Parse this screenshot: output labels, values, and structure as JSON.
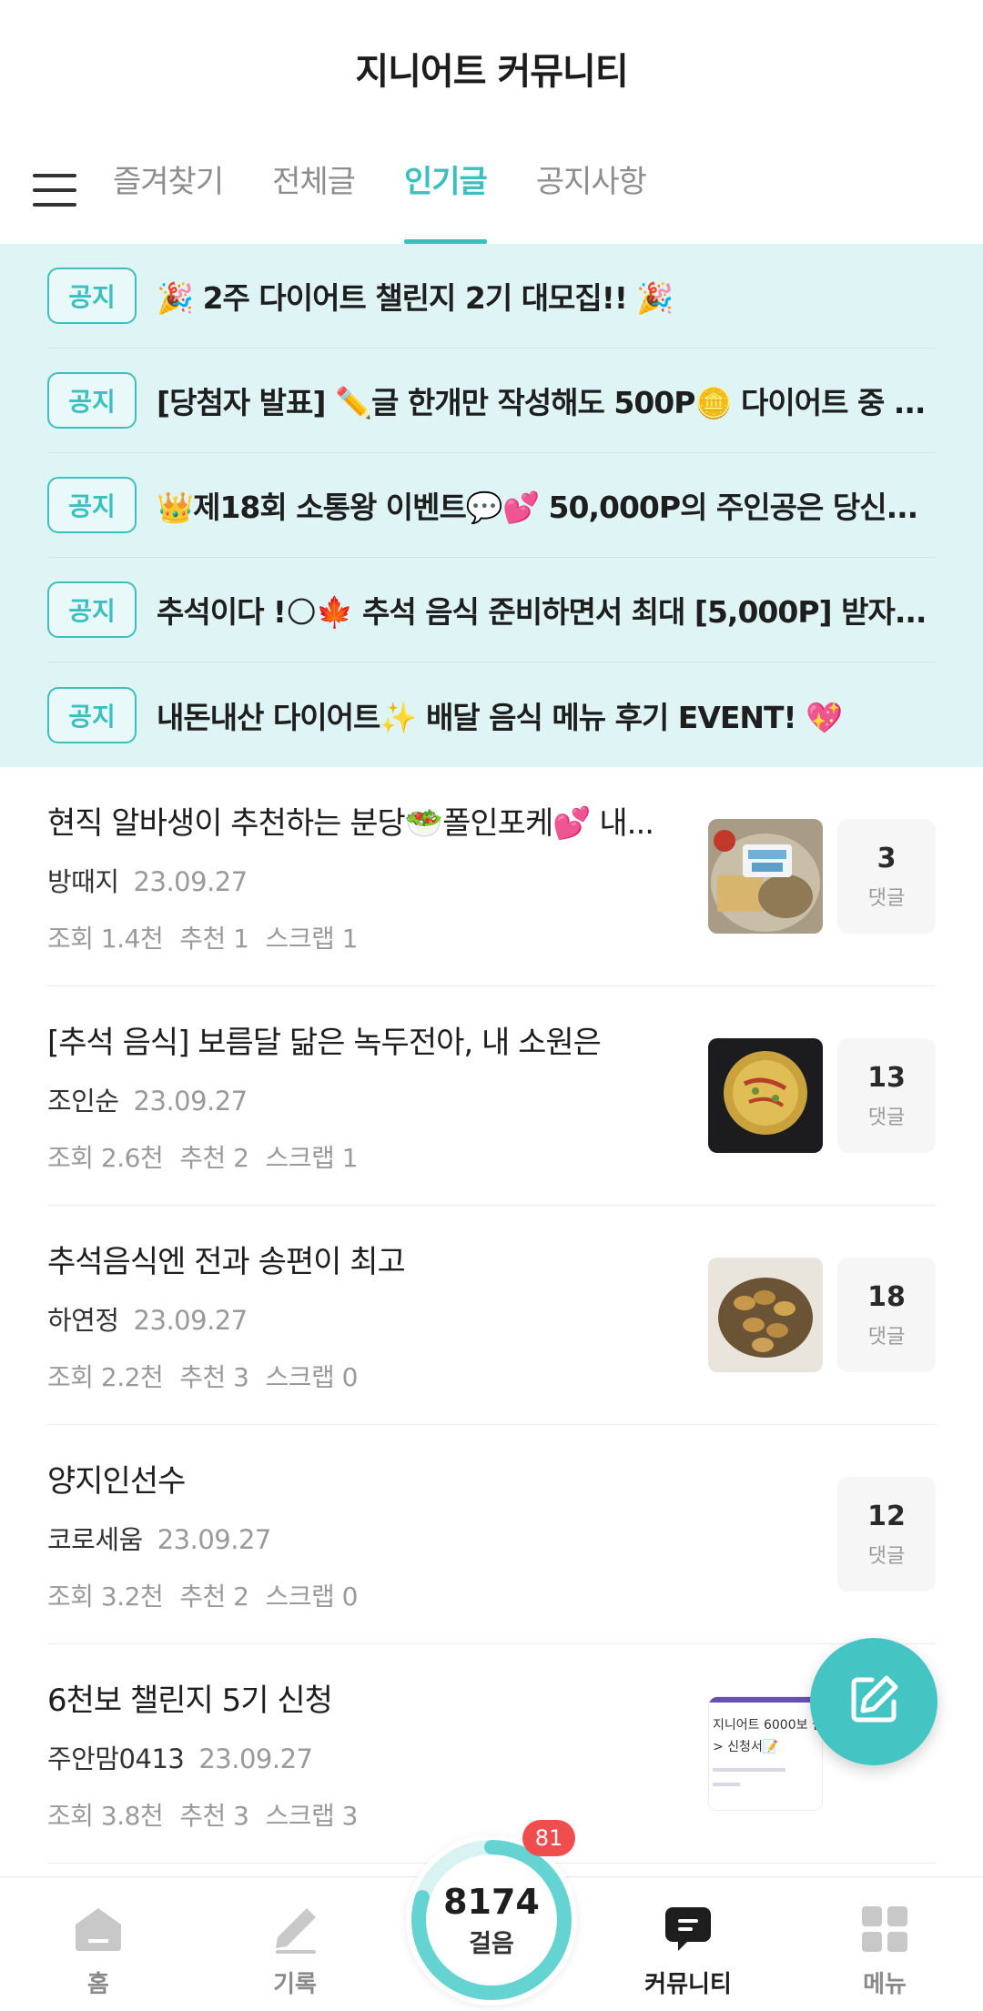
{
  "header": {
    "title": "지니어트 커뮤니티"
  },
  "tabs": [
    {
      "label": "즐겨찾기",
      "active": false
    },
    {
      "label": "전체글",
      "active": false
    },
    {
      "label": "인기글",
      "active": true
    },
    {
      "label": "공지사항",
      "active": false
    }
  ],
  "notices": [
    {
      "badge": "공지",
      "title": "🎉 2주 다이어트 챌린지 2기 대모집!! 🎉"
    },
    {
      "badge": "공지",
      "title": "[당첨자 발표] ✏️글 한개만 작성해도 500P🪙 다이어트 중 ..."
    },
    {
      "badge": "공지",
      "title": "👑제18회 소통왕 이벤트💬💕 50,000P의 주인공은 당신..."
    },
    {
      "badge": "공지",
      "title": "추석이다 !🌕🍁 추석 음식 준비하면서 최대 [5,000P] 받자..."
    },
    {
      "badge": "공지",
      "title": "내돈내산 다이어트✨ 배달 음식 메뉴 후기 EVENT! 💖"
    }
  ],
  "posts": [
    {
      "title": "현직 알바생이 추천하는 분당🥗폴인포케💕 내...",
      "author": "방때지",
      "date": "23.09.27",
      "views": "조회 1.4천",
      "likes": "추천 1",
      "scraps": "스크랩 1",
      "comments": "3",
      "comment_label": "댓글",
      "thumb": "poke-bowl"
    },
    {
      "title": "[추석 음식] 보름달 닮은 녹두전아, 내 소원은",
      "author": "조인순",
      "date": "23.09.27",
      "views": "조회 2.6천",
      "likes": "추천 2",
      "scraps": "스크랩 1",
      "comments": "13",
      "comment_label": "댓글",
      "thumb": "mung-bean-pancake"
    },
    {
      "title": "추석음식엔 전과 송편이 최고",
      "author": "하연정",
      "date": "23.09.27",
      "views": "조회 2.2천",
      "likes": "추천 3",
      "scraps": "스크랩 0",
      "comments": "18",
      "comment_label": "댓글",
      "thumb": "jeon-plate"
    },
    {
      "title": "양지인선수",
      "author": "코로세움",
      "date": "23.09.27",
      "views": "조회 3.2천",
      "likes": "추천 2",
      "scraps": "스크랩 0",
      "comments": "12",
      "comment_label": "댓글",
      "thumb": null
    },
    {
      "title": "6천보 챌린지 5기 신청",
      "author": "주안맘0413",
      "date": "23.09.27",
      "views": "조회 3.8천",
      "likes": "추천 3",
      "scraps": "스크랩 3",
      "comments": "",
      "comment_label": "",
      "thumb": "challenge-form",
      "thumb_text": "지니어트 6000보 챌린",
      "thumb_text2": "> 신청서📝"
    }
  ],
  "fab": {
    "icon": "edit-icon"
  },
  "bottom_nav": [
    {
      "label": "홈",
      "icon": "home-icon",
      "active": false
    },
    {
      "label": "기록",
      "icon": "pencil-icon",
      "active": false
    },
    {
      "label": "커뮤니티",
      "icon": "chat-icon",
      "active": true
    },
    {
      "label": "메뉴",
      "icon": "grid-icon",
      "active": false
    }
  ],
  "steps": {
    "count": "8174",
    "label": "걸음",
    "badge": "81",
    "progress": 0.8
  },
  "colors": {
    "accent": "#3bbfbf",
    "notice_bg": "#dff4f4",
    "badge_red": "#f04e4e"
  }
}
